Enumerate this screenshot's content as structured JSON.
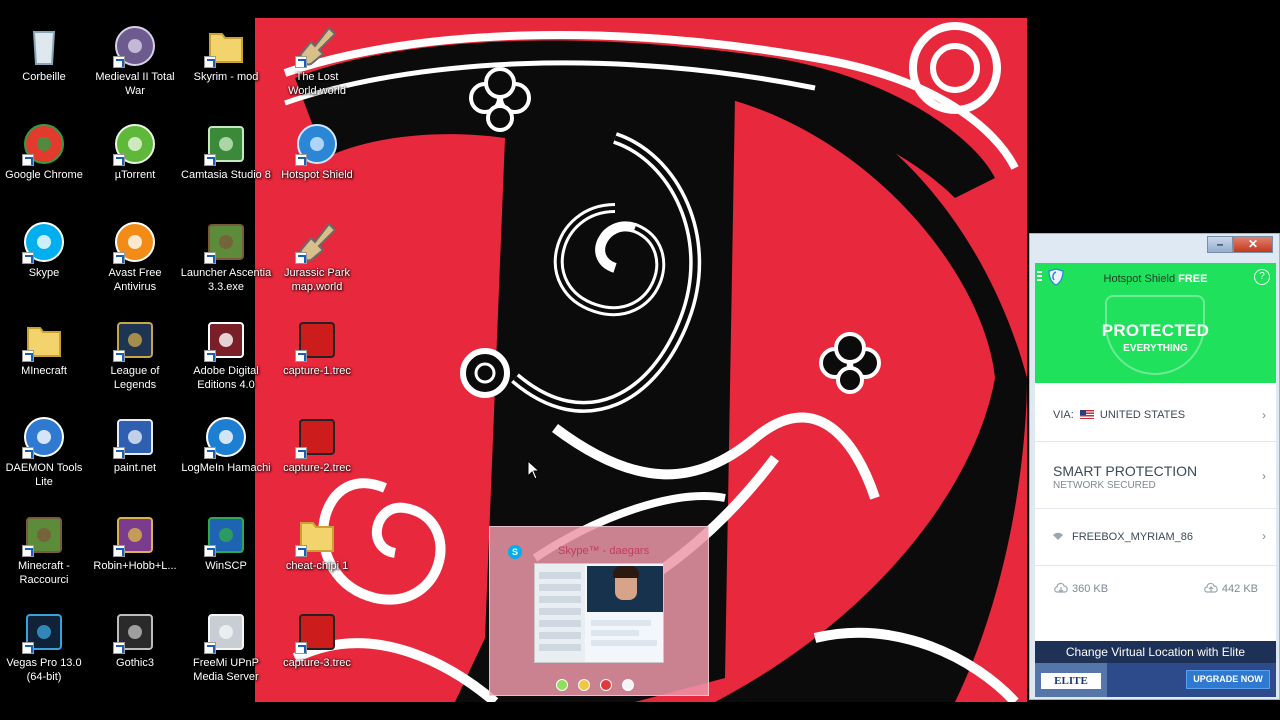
{
  "desktop": {
    "icons": [
      {
        "label": "Corbeille",
        "icon": "recycle-bin-icon"
      },
      {
        "label": "Medieval II Total War",
        "icon": "medieval-game-icon"
      },
      {
        "label": "Skyrim - mod",
        "icon": "folder-icon"
      },
      {
        "label": "The Lost World.world",
        "icon": "shovel-icon"
      },
      {
        "label": "Google Chrome",
        "icon": "chrome-icon"
      },
      {
        "label": "µTorrent",
        "icon": "utorrent-icon"
      },
      {
        "label": "Camtasia Studio 8",
        "icon": "camtasia-icon"
      },
      {
        "label": "Hotspot Shield",
        "icon": "hotspot-shield-icon"
      },
      {
        "label": "Skype",
        "icon": "skype-icon"
      },
      {
        "label": "Avast Free Antivirus",
        "icon": "avast-icon"
      },
      {
        "label": "Launcher Ascentia 3.3.exe",
        "icon": "minecraft-block-icon"
      },
      {
        "label": "Jurassic Park map.world",
        "icon": "shovel-icon"
      },
      {
        "label": "MInecraft",
        "icon": "folder-icon"
      },
      {
        "label": "League of Legends",
        "icon": "league-icon"
      },
      {
        "label": "Adobe Digital Editions 4.0",
        "icon": "adobe-de-icon"
      },
      {
        "label": "capture-1.trec",
        "icon": "trec-file-icon"
      },
      {
        "label": "DAEMON Tools Lite",
        "icon": "daemon-tools-icon"
      },
      {
        "label": "paint.net",
        "icon": "paintnet-icon"
      },
      {
        "label": "LogMeIn Hamachi",
        "icon": "hamachi-icon"
      },
      {
        "label": "capture-2.trec",
        "icon": "trec-file-icon"
      },
      {
        "label": "Minecraft - Raccourci",
        "icon": "minecraft-block-icon"
      },
      {
        "label": "Robin+Hobb+L...",
        "icon": "winrar-icon"
      },
      {
        "label": "WinSCP",
        "icon": "winscp-icon"
      },
      {
        "label": "cheat-chipi 1",
        "icon": "folder-icon"
      },
      {
        "label": "Vegas Pro 13.0 (64-bit)",
        "icon": "vegas-icon"
      },
      {
        "label": "Gothic3",
        "icon": "gothic-icon"
      },
      {
        "label": "FreeMi UPnP Media Server",
        "icon": "freemi-icon"
      },
      {
        "label": "capture-3.trec",
        "icon": "trec-file-icon"
      }
    ]
  },
  "skype_preview": {
    "title": "Skype™ - daegars",
    "button_colors": [
      "#8ee05c",
      "#f2c744",
      "#e23a3a",
      "#f5f5f5"
    ]
  },
  "hotspot_shield": {
    "window_buttons": {
      "minimize": "–",
      "close": "✕"
    },
    "title_plain": "Hotspot Shield",
    "title_bold": "FREE",
    "help": "?",
    "status": "PROTECTED",
    "status_sub": "EVERYTHING",
    "via_label": "VIA:",
    "via_country": "UNITED STATES",
    "smart_title": "SMART PROTECTION",
    "smart_sub": "NETWORK SECURED",
    "network_name": "FREEBOX_MYRIAM_86",
    "download": "360 KB",
    "upload": "442 KB",
    "promo_text": "Change Virtual Location with Elite",
    "elite_badge": "ELITE",
    "upgrade_button": "UPGRADE NOW",
    "colors": {
      "accent_green": "#1fe15b",
      "upgrade_blue": "#2f7ad0"
    }
  }
}
